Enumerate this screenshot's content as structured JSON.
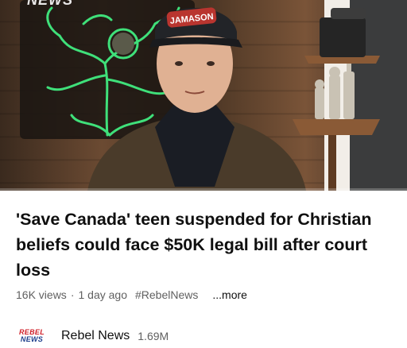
{
  "video": {
    "watermark": "NEWS",
    "cap_text": "JAMASON",
    "progress": 0.0
  },
  "title": "'Save Canada' teen suspended for Christian beliefs could face $50K legal bill after court loss",
  "stats": {
    "views": "16K views",
    "separator": "·",
    "age": "1 day ago",
    "hashtag": "#RebelNews",
    "more": "...more"
  },
  "channel": {
    "logo_line1": "REBEL",
    "logo_line2": "NEWS",
    "name": "Rebel News",
    "subscribers": "1.69M"
  },
  "colors": {
    "progress": "#ff0000",
    "logo_red": "#d0202a",
    "logo_blue": "#1d3e8c",
    "neon_green": "#3fe07a"
  },
  "icons": {
    "tree": "tree-icon",
    "person": "person-silhouette",
    "chess": "chess-pieces"
  }
}
